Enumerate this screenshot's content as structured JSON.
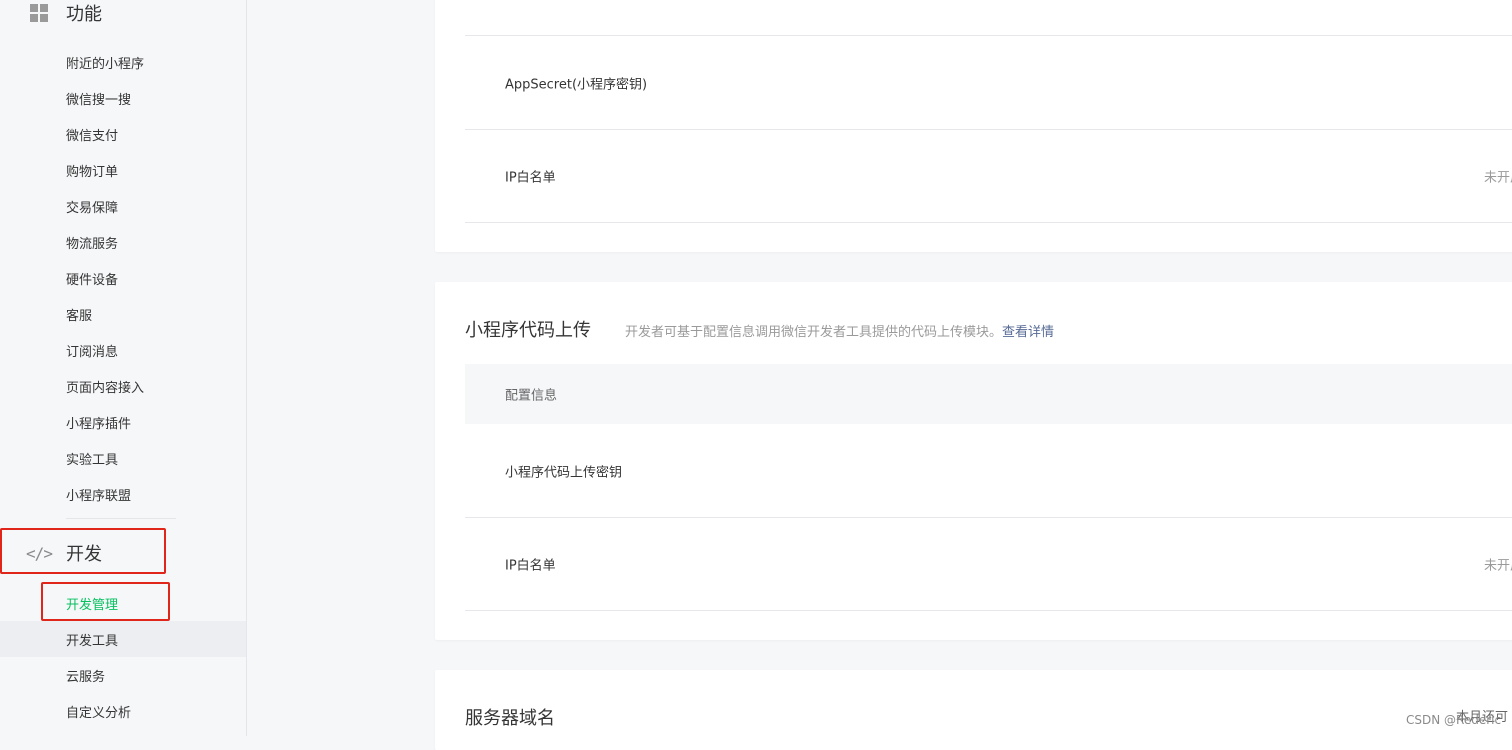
{
  "sidebar": {
    "feature_section": {
      "label": "功能",
      "icon": "grid-icon"
    },
    "feature_items": [
      "附近的小程序",
      "微信搜一搜",
      "微信支付",
      "购物订单",
      "交易保障",
      "物流服务",
      "硬件设备",
      "客服",
      "订阅消息",
      "页面内容接入",
      "小程序插件",
      "实验工具",
      "小程序联盟"
    ],
    "dev_section": {
      "label": "开发",
      "icon": "code-icon",
      "icon_glyph": "</>"
    },
    "dev_items": [
      "开发管理",
      "开发工具",
      "云服务",
      "自定义分析"
    ],
    "active_item": "开发管理",
    "accent_color": "#07c160",
    "highlight_color": "#e0251b"
  },
  "card1": {
    "rows": [
      {
        "key": "AppSecret(小程序密钥)",
        "value": ""
      },
      {
        "key": "IP白名单",
        "value": "未开启"
      }
    ]
  },
  "card2": {
    "title": "小程序代码上传",
    "desc": "开发者可基于配置信息调用微信开发者工具提供的代码上传模块。",
    "desc_link": "查看详情",
    "table_header": "配置信息",
    "rows": [
      {
        "key": "小程序代码上传密钥",
        "value": ""
      },
      {
        "key": "IP白名单",
        "value": "未开启"
      }
    ]
  },
  "card3": {
    "title": "服务器域名",
    "corner_note": "本月还可"
  },
  "watermark": "CSDN @Rederic"
}
